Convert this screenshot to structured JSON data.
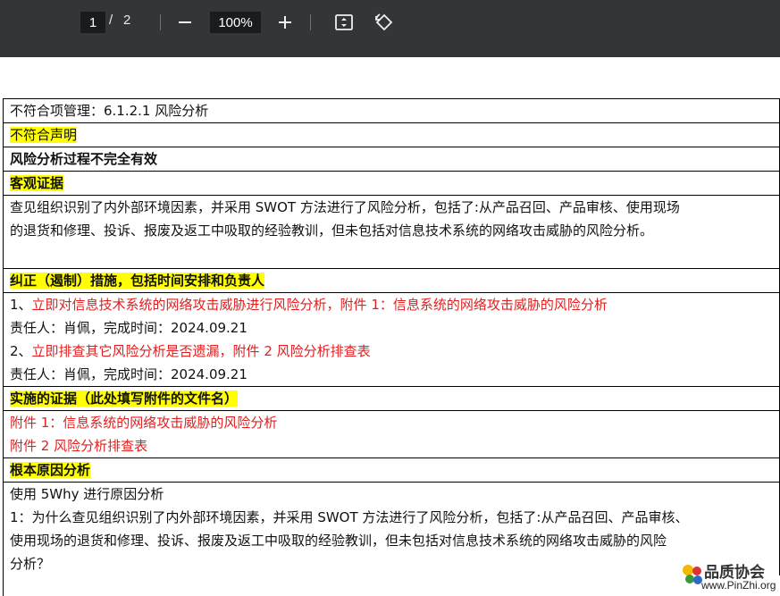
{
  "toolbar": {
    "current_page": "1",
    "page_separator": "/",
    "total_pages": "2",
    "zoom": "100%"
  },
  "doc": {
    "r1": "不符合项管理：6.1.2.1 风险分析",
    "r2": "不符合声明",
    "r3": "风险分析过程不完全有效",
    "r4": "客观证据",
    "r5_l1": "查见组织识别了内外部环境因素，并采用 SWOT 方法进行了风险分析，包括了:从产品召回、产品审核、使用现场",
    "r5_l2": "的退货和修理、投诉、报废及返工中吸取的经验教训，但未包括对信息技术系统的网络攻击威胁的风险分析。",
    "r6": "纠正（遏制）措施，包括时间安排和负责人",
    "r7_l1_prefix": "1、",
    "r7_l1_red": "立即对信息技术系统的网络攻击威胁进行风险分析，附件 1：信息系统的网络攻击威胁的风险分析",
    "r7_l2": "责任人：肖佩，完成时间：2024.09.21",
    "r7_l3_prefix": "2、",
    "r7_l3_red": "立即排查其它风险分析是否遗漏，附件 2 风险分析排查表",
    "r7_l4": "责任人：肖佩，完成时间：2024.09.21",
    "r8": "实施的证据（此处填写附件的文件名）",
    "r9_l1": "附件 1：信息系统的网络攻击威胁的风险分析",
    "r9_l2": "附件 2 风险分析排查表",
    "r10": "根本原因分析",
    "r11_l1": "使用 5Why 进行原因分析",
    "r11_l2": "1：为什么查见组织识别了内外部环境因素，并采用 SWOT 方法进行了风险分析，包括了:从产品召回、产品审核、",
    "r11_l3": "使用现场的退货和修理、投诉、报废及返工中吸取的经验教训，但未包括对信息技术系统的网络攻击威胁的风险",
    "r11_l4": "分析？"
  },
  "watermark": {
    "title": "品质协会",
    "url": "www.PinZhi.org"
  },
  "colors": {
    "toolbar_bg": "#323639",
    "highlight": "#ffff00",
    "red_text": "#e02020"
  }
}
